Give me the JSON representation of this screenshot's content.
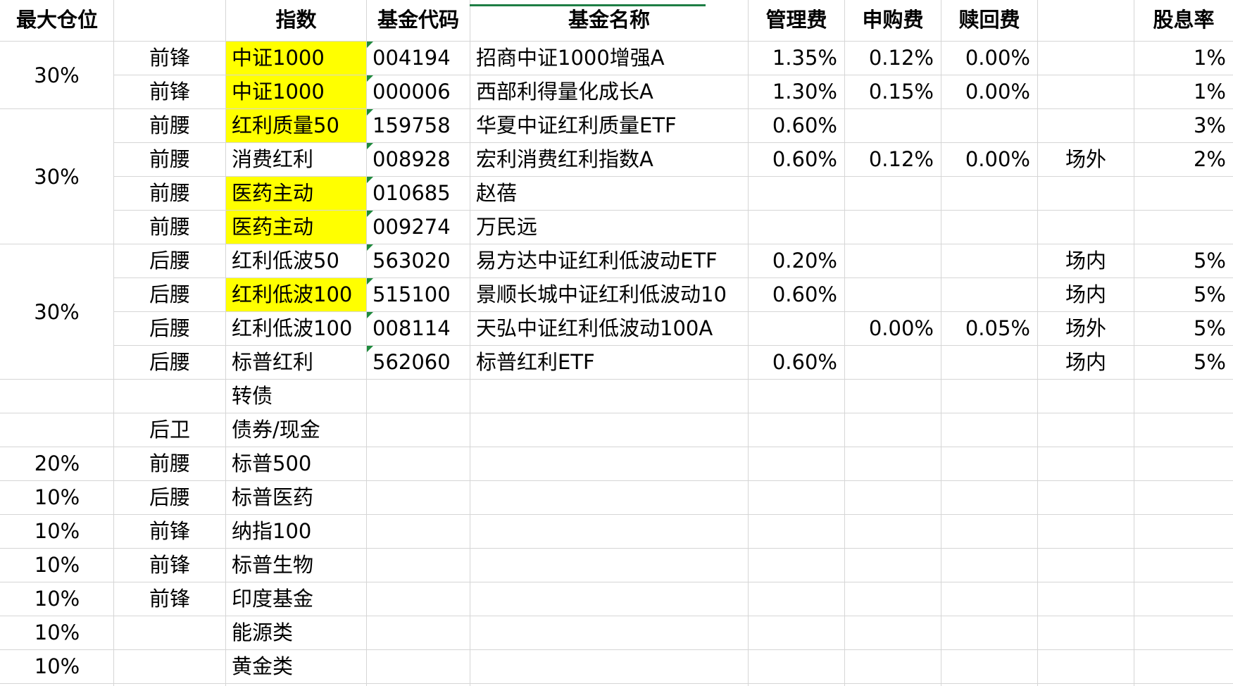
{
  "accent_selected": "#1e7e45",
  "highlight_color": "#ffff00",
  "headers": [
    "最大仓位",
    "",
    "指数",
    "基金代码",
    "基金名称",
    "管理费",
    "申购费",
    "赎回费",
    "",
    "股息率"
  ],
  "position_groups": [
    "30%",
    "30%",
    "30%"
  ],
  "rows": [
    {
      "position": "",
      "role": "前锋",
      "index": "中证1000",
      "index_hl": true,
      "code": "004194",
      "name": "招商中证1000增强A",
      "mgmt": "1.35%",
      "sub": "0.12%",
      "red": "0.00%",
      "market": "",
      "yield": "1%"
    },
    {
      "position": "",
      "role": "前锋",
      "index": "中证1000",
      "index_hl": true,
      "code": "000006",
      "name": "西部利得量化成长A",
      "mgmt": "1.30%",
      "sub": "0.15%",
      "red": "0.00%",
      "market": "",
      "yield": "1%"
    },
    {
      "position": "",
      "role": "前腰",
      "index": "红利质量50",
      "index_hl": true,
      "code": "159758",
      "name": "华夏中证红利质量ETF",
      "mgmt": "0.60%",
      "sub": "",
      "red": "",
      "market": "",
      "yield": "3%"
    },
    {
      "position": "",
      "role": "前腰",
      "index": "消费红利",
      "index_hl": false,
      "code": "008928",
      "name": "宏利消费红利指数A",
      "mgmt": "0.60%",
      "sub": "0.12%",
      "red": "0.00%",
      "market": "场外",
      "yield": "2%"
    },
    {
      "position": "",
      "role": "前腰",
      "index": "医药主动",
      "index_hl": true,
      "code": "010685",
      "name": "赵蓓",
      "mgmt": "",
      "sub": "",
      "red": "",
      "market": "",
      "yield": ""
    },
    {
      "position": "",
      "role": "前腰",
      "index": "医药主动",
      "index_hl": true,
      "code": "009274",
      "name": "万民远",
      "mgmt": "",
      "sub": "",
      "red": "",
      "market": "",
      "yield": ""
    },
    {
      "position": "",
      "role": "后腰",
      "index": "红利低波50",
      "index_hl": false,
      "code": "563020",
      "name": "易方达中证红利低波动ETF",
      "mgmt": "0.20%",
      "sub": "",
      "red": "",
      "market": "场内",
      "yield": "5%"
    },
    {
      "position": "",
      "role": "后腰",
      "index": "红利低波100",
      "index_hl": true,
      "code": "515100",
      "name": "景顺长城中证红利低波动10",
      "mgmt": "0.60%",
      "sub": "",
      "red": "",
      "market": "场内",
      "yield": "5%"
    },
    {
      "position": "",
      "role": "后腰",
      "index": "红利低波100",
      "index_hl": false,
      "code": "008114",
      "name": "天弘中证红利低波动100A",
      "mgmt": "",
      "sub": "0.00%",
      "red": "0.05%",
      "market": "场外",
      "yield": "5%"
    },
    {
      "position": "",
      "role": "后腰",
      "index": "标普红利",
      "index_hl": false,
      "code": "562060",
      "name": "标普红利ETF",
      "mgmt": "0.60%",
      "sub": "",
      "red": "",
      "market": "场内",
      "yield": "5%"
    },
    {
      "position": "",
      "role": "",
      "index": "转债",
      "index_hl": false,
      "code": "",
      "name": "",
      "mgmt": "",
      "sub": "",
      "red": "",
      "market": "",
      "yield": ""
    },
    {
      "position": "",
      "role": "后卫",
      "index": "债券/现金",
      "index_hl": false,
      "code": "",
      "name": "",
      "mgmt": "",
      "sub": "",
      "red": "",
      "market": "",
      "yield": ""
    },
    {
      "position": "20%",
      "role": "前腰",
      "index": "标普500",
      "index_hl": false,
      "code": "",
      "name": "",
      "mgmt": "",
      "sub": "",
      "red": "",
      "market": "",
      "yield": ""
    },
    {
      "position": "10%",
      "role": "后腰",
      "index": "标普医药",
      "index_hl": false,
      "code": "",
      "name": "",
      "mgmt": "",
      "sub": "",
      "red": "",
      "market": "",
      "yield": ""
    },
    {
      "position": "10%",
      "role": "前锋",
      "index": "纳指100",
      "index_hl": false,
      "code": "",
      "name": "",
      "mgmt": "",
      "sub": "",
      "red": "",
      "market": "",
      "yield": ""
    },
    {
      "position": "10%",
      "role": "前锋",
      "index": "标普生物",
      "index_hl": false,
      "code": "",
      "name": "",
      "mgmt": "",
      "sub": "",
      "red": "",
      "market": "",
      "yield": ""
    },
    {
      "position": "10%",
      "role": "前锋",
      "index": "印度基金",
      "index_hl": false,
      "code": "",
      "name": "",
      "mgmt": "",
      "sub": "",
      "red": "",
      "market": "",
      "yield": ""
    },
    {
      "position": "10%",
      "role": "",
      "index": "能源类",
      "index_hl": false,
      "code": "",
      "name": "",
      "mgmt": "",
      "sub": "",
      "red": "",
      "market": "",
      "yield": ""
    },
    {
      "position": "10%",
      "role": "",
      "index": "黄金类",
      "index_hl": false,
      "code": "",
      "name": "",
      "mgmt": "",
      "sub": "",
      "red": "",
      "market": "",
      "yield": ""
    }
  ]
}
